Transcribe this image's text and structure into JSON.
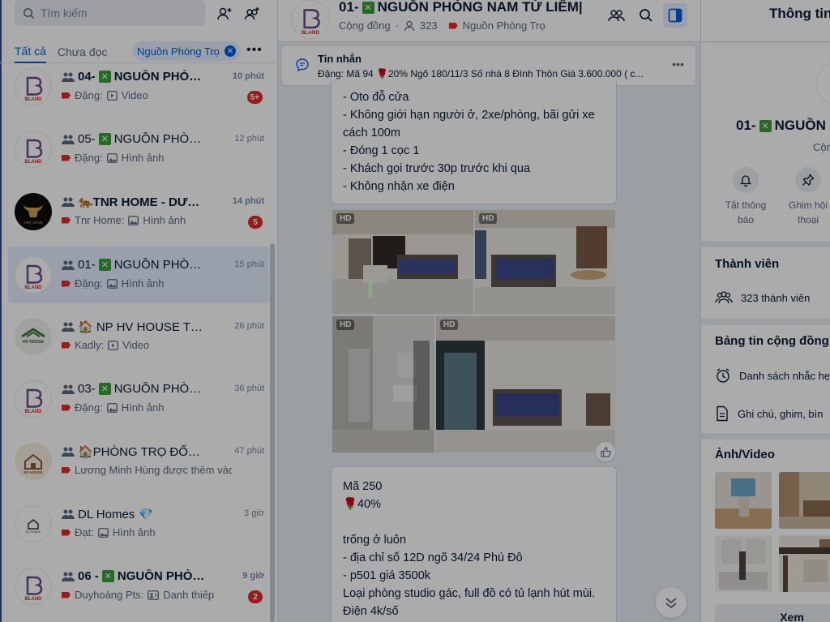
{
  "search": {
    "placeholder": "Tìm kiếm"
  },
  "tabs": {
    "all": "Tất cả",
    "unread": "Chưa đọc"
  },
  "filter_chip": {
    "label": "Nguồn Phòng Trọ"
  },
  "conversations": [
    {
      "title_prefix": "04-",
      "title": "NGUỒN PHÒNG...",
      "time": "10 phút",
      "sender": "Đặng:",
      "preview": "Video",
      "badge": "5+",
      "avatar": "BLAND"
    },
    {
      "title_prefix": "05-",
      "title": "NGUỒN PHÒNG...",
      "time": "12 phút",
      "sender": "Đặng:",
      "preview": "Hình ảnh",
      "badge": "",
      "avatar": "BLAND"
    },
    {
      "title_prefix": "",
      "title": "🐅TNR HOME - DƯỚI ...",
      "time": "14 phút",
      "sender": "Tnr Home:",
      "preview": "Hình ảnh",
      "badge": "5",
      "avatar": "TNR HOME"
    },
    {
      "title_prefix": "01-",
      "title": "NGUỒN PHÒNG ...",
      "time": "15 phút",
      "sender": "Đặng:",
      "preview": "Hình ảnh",
      "badge": "",
      "avatar": "BLAND"
    },
    {
      "title_prefix": "",
      "title": "🏠 NP HV HOUSE TỔNG",
      "time": "26 phút",
      "sender": "Kadly:",
      "preview": "Video",
      "badge": "",
      "avatar": "HV HOUSE"
    },
    {
      "title_prefix": "03-",
      "title": "NGUỒN PHÒNG...",
      "time": "36 phút",
      "sender": "Đặng:",
      "preview": "Hình ảnh",
      "badge": "",
      "avatar": "BLAND"
    },
    {
      "title_prefix": "",
      "title": "🏠PHÒNG TRỌ ĐỐNG ...",
      "time": "47 phút",
      "sender": "",
      "preview": "Lương Minh Hùng được thêm vào ...",
      "badge": "",
      "avatar": "EP HOUSE"
    },
    {
      "title_prefix": "",
      "title": "DL Homes 💎",
      "time": "3 giờ",
      "sender": "Đạt:",
      "preview": "Hình ảnh",
      "badge": "",
      "avatar": "DL HOMES"
    },
    {
      "title_prefix": "06 - ",
      "title": "NGUỒN PHÒNG ...",
      "time": "9 giờ",
      "sender": "Duyhoàng Pts:",
      "preview": "Danh thiếp",
      "badge": "2",
      "avatar": "BLAND"
    }
  ],
  "chat": {
    "title_prefix": "01-",
    "title": "NGUỒN PHÒNG NAM TỪ LIÊM|",
    "type": "Cộng đồng",
    "members": "323",
    "label": "Nguồn Phòng Trọ",
    "pinned_label": "Tin nhắn",
    "pinned_text": "Đặng: Mã 94 🌹20% Ngõ 180/11/3 Số nhà 8 Đình Thôn Giá 3.600.000 ( c...",
    "bubble1": "- Oto đỗ cửa\n- Không giới hạn người ở, 2xe/phòng, bãi gửi xe cách 100m\n- Đóng 1 cọc 1\n- Khách gọi trước 30p trước khi qua\n- Không nhận xe điện",
    "hd_label": "HD",
    "bubble2": "Mã 250\n🌹40%\n\ntrống ở luôn\n- địa chỉ số 12D ngõ 34/24 Phú Đô\n- p501 giá 3500k\nLoại phòng studio gác, full đồ có tủ lạnh hút mùi.\nĐiện 4k/số"
  },
  "info": {
    "header_title": "Thông tin",
    "name_prefix": "01-",
    "name": "NGUỒN",
    "sub": "Cộn",
    "actions": [
      {
        "label": "Tắt thông báo"
      },
      {
        "label": "Ghim hội thoại"
      }
    ],
    "members_title": "Thành viên",
    "members_count": "323 thành viên",
    "board_title": "Bảng tin cộng đồng",
    "reminder": "Danh sách nhắc hẹ",
    "notes": "Ghi chú, ghim, bìn",
    "media_title": "Ảnh/Video",
    "see_all": "Xem"
  },
  "colors": {
    "accent": "#005ae0",
    "badge": "#e12c2c",
    "tag": "#e12c2c",
    "xbox": "#3a9f3a"
  }
}
